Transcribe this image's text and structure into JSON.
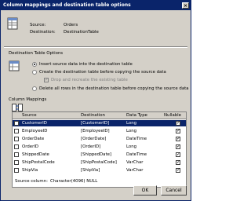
{
  "window": {
    "title": "Column mappings and destination table options",
    "close_glyph": "×"
  },
  "info": {
    "source_label": "Source:",
    "source_value": "Orders",
    "destination_label": "Destination:",
    "destination_value": "DestinationTable"
  },
  "options": {
    "group_label": "Destination Table Options",
    "insert_label": "Insert source data into the destination table",
    "create_label": "Create the destination table before copying the source data",
    "drop_label": "Drop and recreate the existing table",
    "delete_label": "Delete all rows in the destination table before copying the source data",
    "selected": "insert"
  },
  "mappings": {
    "group_label": "Column Mappings",
    "headers": [
      "Source",
      "Destination",
      "Data Type",
      "Nullable"
    ],
    "rows": [
      {
        "source": "CustomerID",
        "destination": "[CustomerID]",
        "type": "Long",
        "nullable": true,
        "selected": true
      },
      {
        "source": "EmployeeID",
        "destination": "[EmployeeID]",
        "type": "Long",
        "nullable": true,
        "selected": false
      },
      {
        "source": "OrderDate",
        "destination": "[OrderDate]",
        "type": "DateTime",
        "nullable": true,
        "selected": false
      },
      {
        "source": "OrderID",
        "destination": "[OrderID]",
        "type": "Long",
        "nullable": true,
        "selected": false
      },
      {
        "source": "ShippedDate",
        "destination": "[ShippedDate]",
        "type": "DateTime",
        "nullable": true,
        "selected": false
      },
      {
        "source": "ShipPostalCode",
        "destination": "[ShipPostalCode]",
        "type": "VarChar",
        "nullable": true,
        "selected": false
      },
      {
        "source": "ShipVia",
        "destination": "[ShipVia]",
        "type": "VarChar",
        "nullable": true,
        "selected": false
      }
    ],
    "source_column_label": "Source column:",
    "source_column_value": "Character(4096) NULL"
  },
  "buttons": {
    "ok": "OK",
    "cancel": "Cancel"
  },
  "colors": {
    "title_bg": "#0a246a",
    "face": "#d4d0c8",
    "selection": "#0a246a"
  },
  "icons": {
    "info": "table-mapping-icon",
    "options": "table-options-icon",
    "mappings": "column-mapping-icon"
  }
}
